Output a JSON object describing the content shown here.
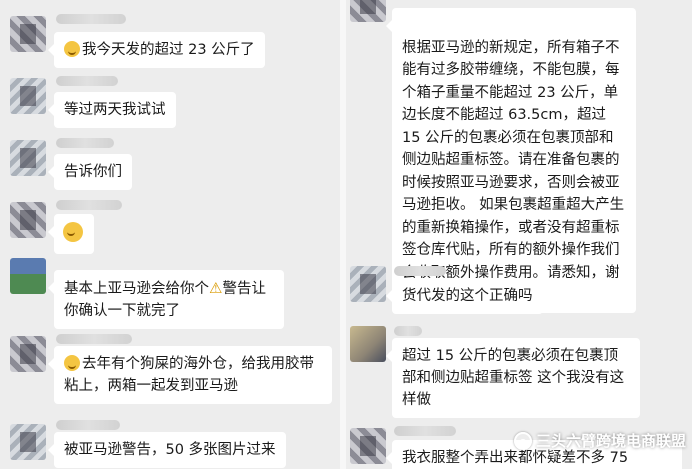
{
  "left_chat": {
    "messages": [
      {
        "text": "我今天发的超过 23 公斤了",
        "has_emoji": true
      },
      {
        "text": "等过两天我试试"
      },
      {
        "text": "告诉你们"
      },
      {
        "text": "",
        "emoji_only": true
      },
      {
        "text_before": "基本上亚马逊会给你个",
        "icon": "warning-icon",
        "text_after": "警告让你确认一下就完了"
      },
      {
        "text": "去年有个狗屎的海外仓，给我用胶带粘上，两箱一起发到亚马逊",
        "has_emoji": true
      },
      {
        "text": "被亚马逊警告，50 多张图片过来"
      }
    ]
  },
  "right_chat": {
    "messages": [
      {
        "text": "根据亚马逊的新规定，所有箱子不能有过多胶带缠绕，不能包膜，每个箱子重量不能超过 23 公斤，单边长度不能超过 63.5cm，超过 15 公斤的包裹必须在包裹顶部和侧边贴超重标签。请在准备包裹的时候按照亚马逊要求，否则会被亚马逊拒收。 如果包裹超重超大产生的重新换箱操作，或者没有超重标签仓库代贴，所有的额外操作我们会收取额外操作费用。请悉知，谢谢。"
      },
      {
        "text": "货代发的这个正确吗"
      },
      {
        "text": "超过 15 公斤的包裹必须在包裹顶部和侧边贴超重标签 这个我没有这样做"
      },
      {
        "text": "我衣服整个弄出来都怀疑差不多 75"
      }
    ]
  },
  "watermark": {
    "text": "三头六臂跨境电商联盟",
    "icon": "wechat-official-account-icon"
  },
  "colors": {
    "background": "#ededed",
    "bubble": "#ffffff",
    "text": "#1a1a1a",
    "divider": "#f7f7f7"
  }
}
